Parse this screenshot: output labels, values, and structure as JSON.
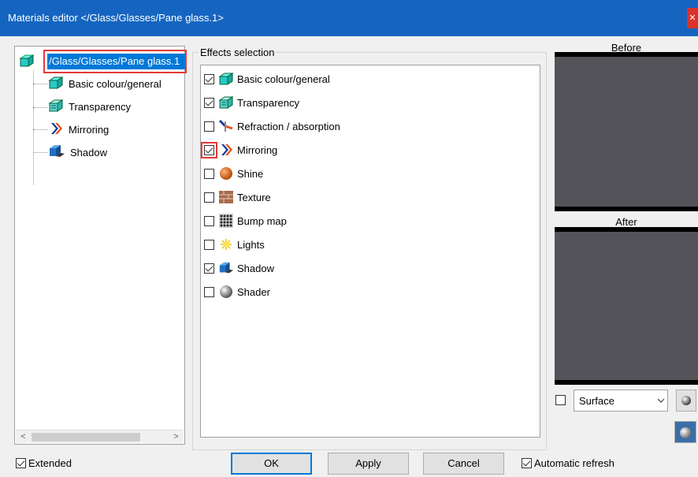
{
  "window": {
    "title": "Materials editor  </Glass/Glasses/Pane glass.1>",
    "close_glyph": "✕"
  },
  "tree": {
    "root_label": "/Glass/Glasses/Pane glass.1",
    "items": [
      {
        "label": "Basic colour/general",
        "icon": "glass-cube-icon"
      },
      {
        "label": "Transparency",
        "icon": "transparency-icon"
      },
      {
        "label": "Mirroring",
        "icon": "mirroring-icon"
      },
      {
        "label": "Shadow",
        "icon": "shadow-icon"
      }
    ],
    "scroll_left": "<",
    "scroll_right": ">"
  },
  "effects": {
    "legend": "Effects selection",
    "items": [
      {
        "label": "Basic colour/general",
        "checked": true,
        "icon": "glass-cube-icon"
      },
      {
        "label": "Transparency",
        "checked": true,
        "icon": "transparency-icon"
      },
      {
        "label": "Refraction / absorption",
        "checked": false,
        "icon": "refraction-icon"
      },
      {
        "label": "Mirroring",
        "checked": true,
        "icon": "mirroring-icon"
      },
      {
        "label": "Shine",
        "checked": false,
        "icon": "shine-icon"
      },
      {
        "label": "Texture",
        "checked": false,
        "icon": "texture-icon"
      },
      {
        "label": "Bump map",
        "checked": false,
        "icon": "bump-map-icon"
      },
      {
        "label": "Lights",
        "checked": false,
        "icon": "lights-icon"
      },
      {
        "label": "Shadow",
        "checked": true,
        "icon": "shadow-icon"
      },
      {
        "label": "Shader",
        "checked": false,
        "icon": "shader-icon"
      }
    ]
  },
  "preview": {
    "before_label": "Before",
    "after_label": "After",
    "surface_value": "Surface",
    "surface_checked": false
  },
  "footer": {
    "extended_label": "Extended",
    "extended_checked": true,
    "ok_label": "OK",
    "apply_label": "Apply",
    "cancel_label": "Cancel",
    "auto_refresh_label": "Automatic refresh",
    "auto_refresh_checked": true
  },
  "colors": {
    "titlebar": "#1565c0",
    "selection": "#0078d7",
    "highlight_outline": "#e53935",
    "preview_bg": "#535359"
  }
}
